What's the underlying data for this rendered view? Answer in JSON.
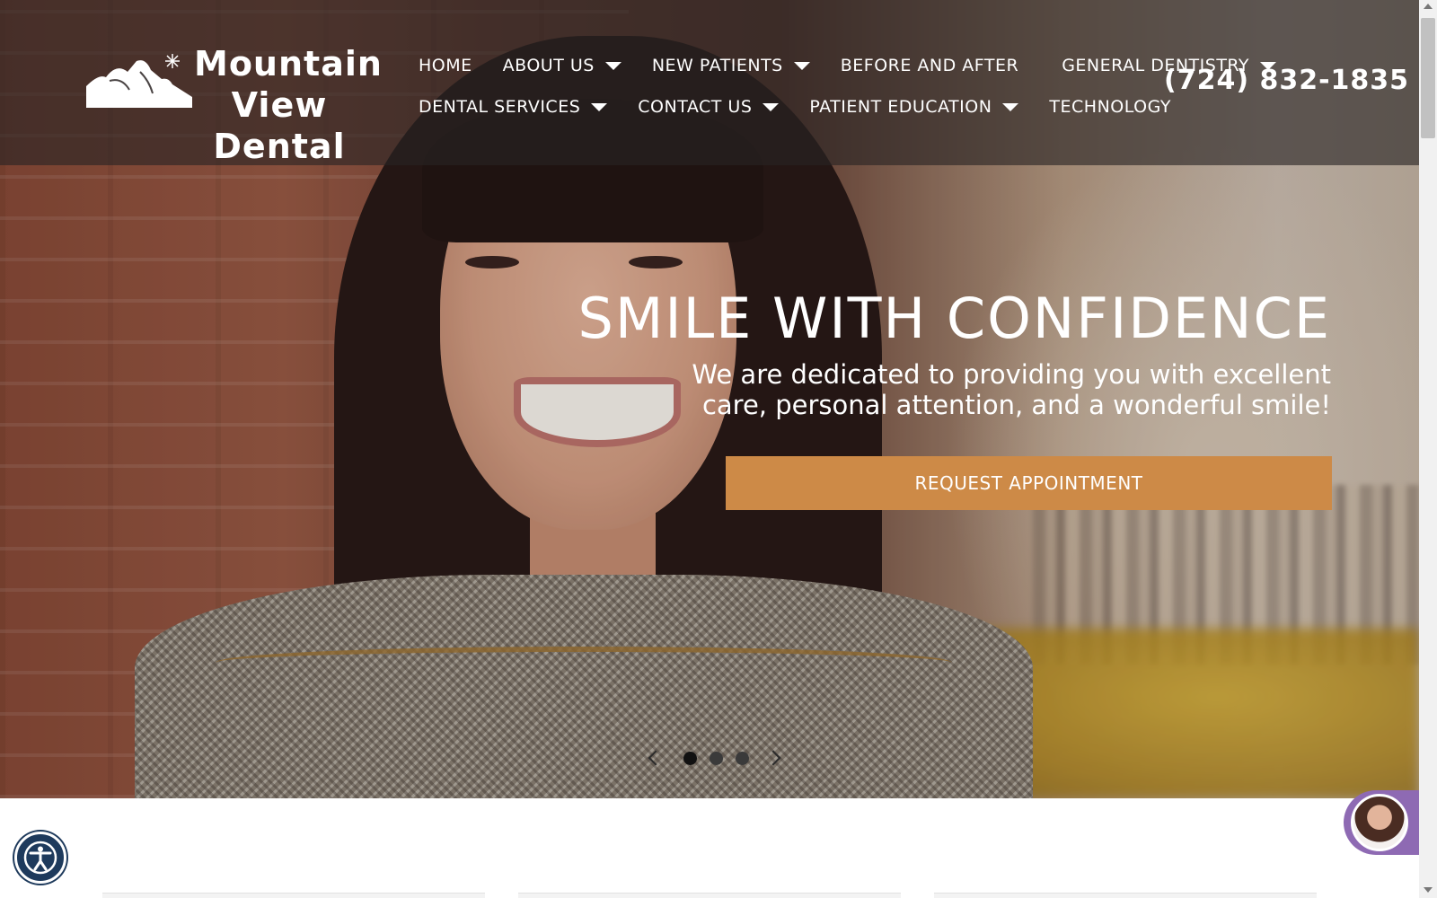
{
  "brand": {
    "name_line1": "Mountain",
    "name_line2": "View Dental"
  },
  "nav": {
    "row1": [
      {
        "label": "HOME",
        "has_dropdown": false
      },
      {
        "label": "ABOUT US",
        "has_dropdown": true
      },
      {
        "label": "NEW PATIENTS",
        "has_dropdown": true
      },
      {
        "label": "BEFORE AND AFTER",
        "has_dropdown": false
      },
      {
        "label": "GENERAL DENTISTRY",
        "has_dropdown": true
      }
    ],
    "row2": [
      {
        "label": "DENTAL SERVICES",
        "has_dropdown": true
      },
      {
        "label": "CONTACT US",
        "has_dropdown": true
      },
      {
        "label": "PATIENT EDUCATION",
        "has_dropdown": true
      },
      {
        "label": "TECHNOLOGY",
        "has_dropdown": false
      }
    ]
  },
  "phone": "(724) 832-1835",
  "hero": {
    "title": "SMILE WITH CONFIDENCE",
    "subtitle": "We are dedicated to providing you with excellent care, personal attention, and a wonderful smile!",
    "cta_label": "REQUEST APPOINTMENT"
  },
  "slider": {
    "slide_count": 3,
    "active_index": 0
  },
  "colors": {
    "accent": "#cd8a47",
    "header_overlay": "#282424",
    "accessibility": "#1e3a5c",
    "chat": "#8e6ab3"
  },
  "icons": {
    "accessibility": "accessibility-icon",
    "chat": "chat-agent-avatar",
    "logo": "mountain-logo-icon"
  }
}
